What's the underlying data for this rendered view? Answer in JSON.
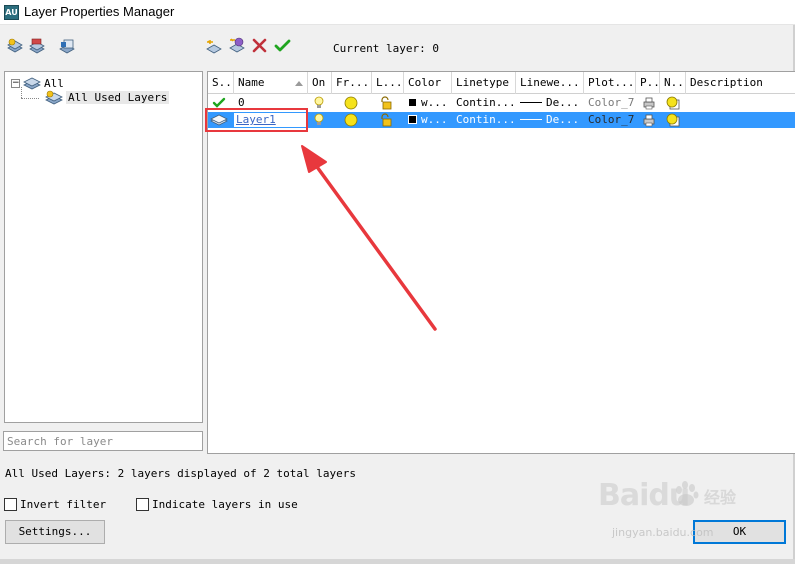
{
  "window": {
    "title": "Layer Properties Manager",
    "app_icon_label": "AU"
  },
  "toolbar": {
    "left_icons": [
      "new-property-filter-icon",
      "new-group-filter-icon",
      "layer-states-manager-icon"
    ],
    "right_icons": [
      "new-layer-icon",
      "new-layer-vp-frozen-icon",
      "delete-layer-icon",
      "set-current-icon"
    ],
    "current_layer_text": "Current layer: 0"
  },
  "tree": {
    "root_expander": "−",
    "root_label": "All",
    "child_label": "All Used Layers"
  },
  "search": {
    "placeholder": "Search for layer"
  },
  "grid": {
    "columns": [
      "S..",
      "Name",
      "On",
      "Fr...",
      "L...",
      "Color",
      "Linetype",
      "Linewe...",
      "Plot...",
      "P..",
      "N..",
      "Description"
    ],
    "rows": [
      {
        "status": "current",
        "name": "0",
        "color": "w...",
        "linetype": "Contin...",
        "lineweight": "De...",
        "plot_style": "Color_7",
        "selected": false
      },
      {
        "status": "layer",
        "name": "Layer1",
        "color": "w...",
        "linetype": "Contin...",
        "lineweight": "De...",
        "plot_style": "Color_7",
        "selected": true
      }
    ]
  },
  "status_bar": {
    "text": "All Used Layers: 2 layers displayed of 2 total layers"
  },
  "options": {
    "invert_filter": "Invert filter",
    "indicate_layers": "Indicate layers in use"
  },
  "buttons": {
    "settings": "Settings...",
    "ok": "OK"
  },
  "watermark": {
    "brand": "Baidu",
    "cn": "经验",
    "url": "jingyan.baidu.com"
  },
  "colors": {
    "selection": "#3399ff",
    "annotation": "#e8383d",
    "check": "#1fa51f",
    "delete": "#c0303a"
  }
}
